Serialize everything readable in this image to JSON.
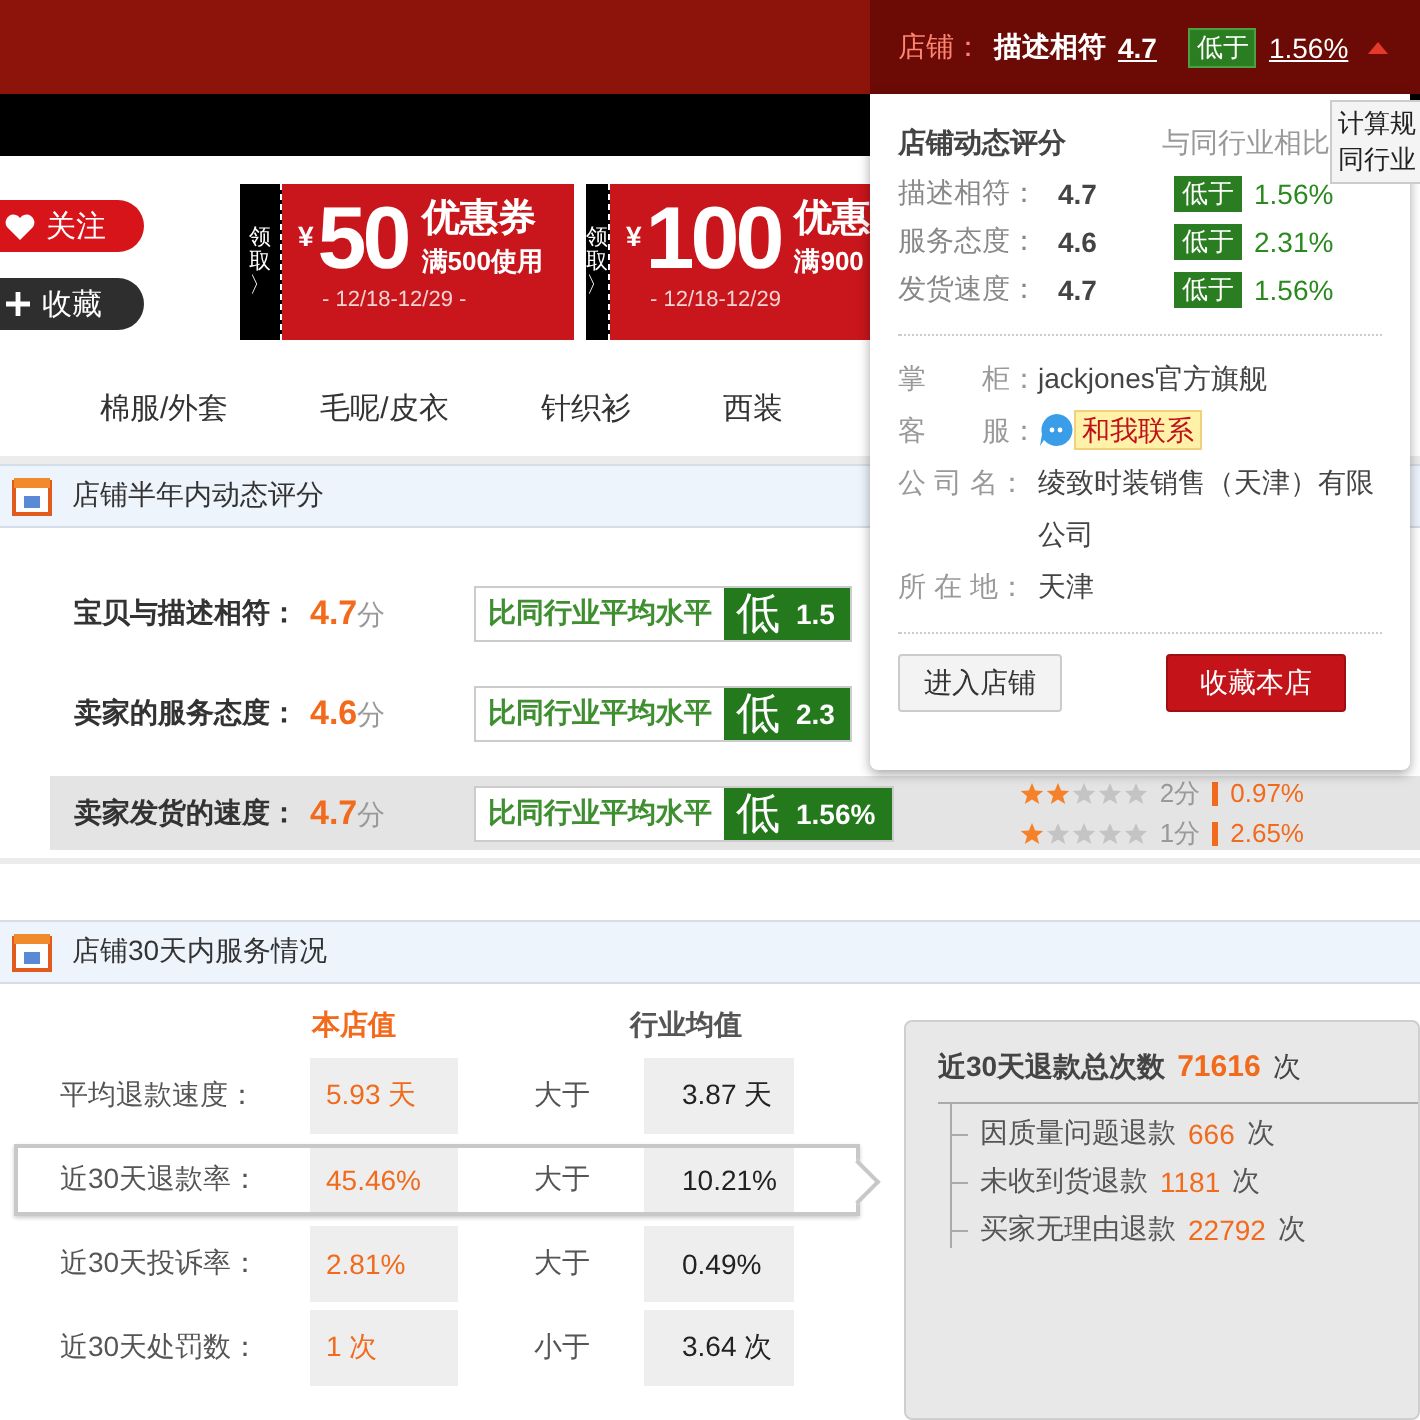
{
  "header": {
    "shop_label": "店铺：",
    "metric": "描述相符",
    "score": "4.7",
    "badge": "低于",
    "percent": "1.56%"
  },
  "side_buttons": [
    {
      "kind": "follow",
      "label": "关注"
    },
    {
      "kind": "favorite",
      "label": "收藏"
    }
  ],
  "coupons": [
    {
      "tab": "领取〉",
      "currency": "¥",
      "amount": "50",
      "title": "优惠券",
      "condition": "满500使用",
      "dates": "- 12/18-12/29 -"
    },
    {
      "tab": "领取〉",
      "currency": "¥",
      "amount": "100",
      "title": "优惠",
      "condition": "满900",
      "dates": "- 12/18-12/29"
    }
  ],
  "categories": [
    "棉服/外套",
    "毛呢/皮衣",
    "针织衫",
    "西装"
  ],
  "rating_section": {
    "title": "店铺半年内动态评分",
    "rows": [
      {
        "label": "宝贝与描述相符：",
        "score": "4.7",
        "unit": "分",
        "tag": "比同行业平均水平",
        "level_text": "低",
        "percent": "1.5",
        "selected": false
      },
      {
        "label": "卖家的服务态度：",
        "score": "4.6",
        "unit": "分",
        "tag": "比同行业平均水平",
        "level_text": "低",
        "percent": "2.3",
        "selected": false
      },
      {
        "label": "卖家发货的速度：",
        "score": "4.7",
        "unit": "分",
        "tag": "比同行业平均水平",
        "level_text": "低",
        "percent": "1.56%",
        "selected": true
      }
    ],
    "distribution": [
      {
        "stars": 2,
        "label": "2分",
        "percent": "0.97%"
      },
      {
        "stars": 1,
        "label": "1分",
        "percent": "2.65%"
      }
    ]
  },
  "service_section": {
    "title": "店铺30天内服务情况",
    "columns": [
      "本店值",
      "行业均值"
    ],
    "rows": [
      {
        "label": "平均退款速度：",
        "shop_value": "5.93 天",
        "comparison": "大于",
        "industry_value": "3.87 天",
        "selected": false
      },
      {
        "label": "近30天退款率：",
        "shop_value": "45.46%",
        "comparison": "大于",
        "industry_value": "10.21%",
        "selected": true
      },
      {
        "label": "近30天投诉率：",
        "shop_value": "2.81%",
        "comparison": "大于",
        "industry_value": "0.49%",
        "selected": false
      },
      {
        "label": "近30天处罚数：",
        "shop_value": "1 次",
        "comparison": "小于",
        "industry_value": "3.64 次",
        "selected": false
      }
    ],
    "refund_summary": {
      "title": "近30天退款总次数",
      "count": "71616",
      "unit": "次",
      "items": [
        {
          "label": "因质量问题退款",
          "count": "666",
          "unit": "次"
        },
        {
          "label": "未收到货退款",
          "count": "1181",
          "unit": "次"
        },
        {
          "label": "买家无理由退款",
          "count": "22792",
          "unit": "次"
        }
      ]
    }
  },
  "popup": {
    "title": "店铺动态评分",
    "compare_title": "与同行业相比",
    "scores": [
      {
        "label": "描述相符：",
        "score": "4.7",
        "badge": "低于",
        "percent": "1.56%"
      },
      {
        "label": "服务态度：",
        "score": "4.6",
        "badge": "低于",
        "percent": "2.31%"
      },
      {
        "label": "发货速度：",
        "score": "4.7",
        "badge": "低于",
        "percent": "1.56%"
      }
    ],
    "info": [
      {
        "kind": "text",
        "label": "掌　　柜：",
        "value": "jackjones官方旗舰"
      },
      {
        "kind": "contact",
        "label": "客　　服：",
        "value": "和我联系"
      },
      {
        "kind": "text",
        "label": "公 司 名：",
        "value": "绫致时装销售（天津）有限公司"
      },
      {
        "kind": "text",
        "label": "所 在 地：",
        "value": "天津"
      }
    ],
    "buttons": [
      {
        "kind": "secondary",
        "label": "进入店铺"
      },
      {
        "kind": "primary",
        "label": "收藏本店"
      }
    ]
  },
  "tooltip": {
    "lines": [
      "计算规",
      "同行业"
    ]
  }
}
